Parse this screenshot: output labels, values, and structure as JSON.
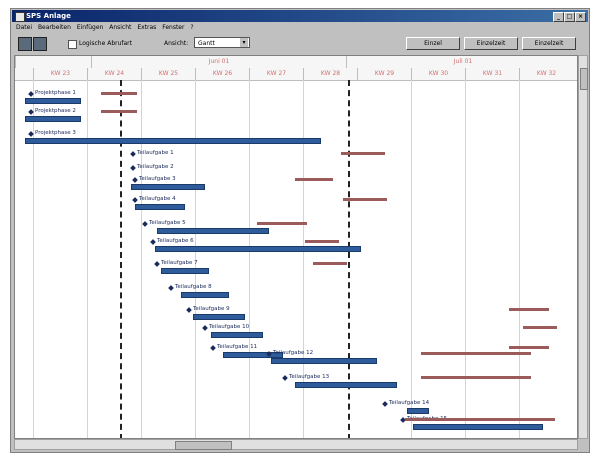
{
  "window": {
    "title": "SPS Anlage"
  },
  "menu": [
    "Datei",
    "Bearbeiten",
    "Einfügen",
    "Ansicht",
    "Extras",
    "Fenster",
    "?"
  ],
  "toolbar": {
    "checkbox_label": "Logische Abrufart",
    "select_label": "Ansicht:",
    "select_value": "Gantt",
    "buttons": [
      "Einzel",
      "Einzelzeit",
      "Einzelzeit"
    ]
  },
  "timeline": {
    "months": [
      "Juni 01",
      "Juli 01"
    ],
    "weeks": [
      "KW 23",
      "KW 24",
      "KW 25",
      "KW 26",
      "KW 27",
      "KW 28",
      "KW 29",
      "KW 30",
      "KW 31",
      "KW 32"
    ]
  },
  "colors": {
    "plan": "#2e5c9a",
    "ist": "#9b5b5b",
    "grid": "#f0c8c8",
    "title": "#0a246a"
  },
  "tasks": [
    {
      "label": "Projektphase 1"
    },
    {
      "label": "Projektphase 2"
    },
    {
      "label": "Projektphase 3"
    },
    {
      "label": "Teilaufgabe 1"
    },
    {
      "label": "Teilaufgabe 2"
    },
    {
      "label": "Teilaufgabe 3"
    },
    {
      "label": "Teilaufgabe 4"
    },
    {
      "label": "Teilaufgabe 5"
    },
    {
      "label": "Teilaufgabe 6"
    },
    {
      "label": "Teilaufgabe 7"
    },
    {
      "label": "Teilaufgabe 8"
    },
    {
      "label": "Teilaufgabe 9"
    },
    {
      "label": "Teilaufgabe 10"
    },
    {
      "label": "Teilaufgabe 11"
    },
    {
      "label": "Teilaufgabe 12"
    },
    {
      "label": "Teilaufgabe 13"
    },
    {
      "label": "Teilaufgabe 14"
    },
    {
      "label": "Teilaufgabe 15"
    }
  ]
}
